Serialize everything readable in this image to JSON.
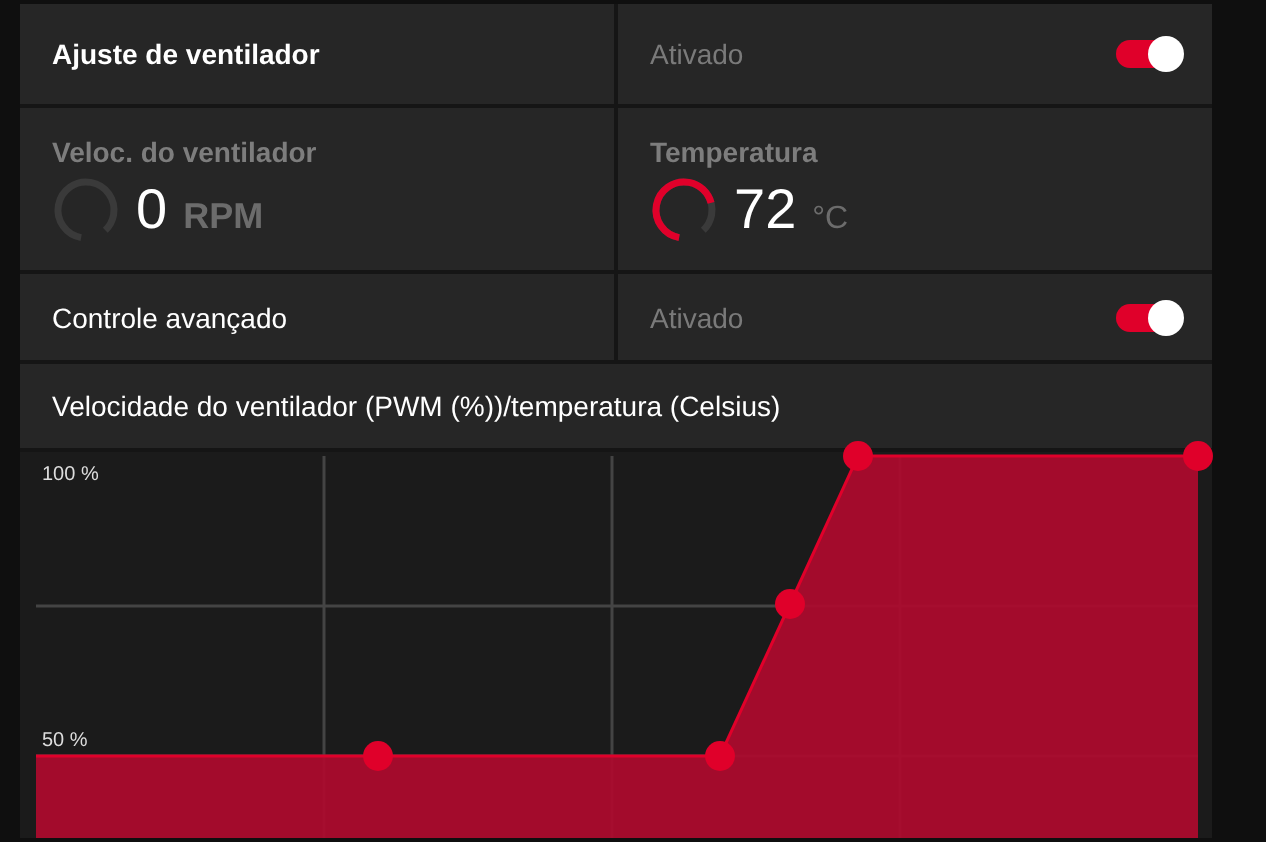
{
  "fan_tuning": {
    "label": "Ajuste de ventilador",
    "status": "Ativado",
    "on": true
  },
  "stats": [
    {
      "label": "Veloc. do ventilador",
      "value": "0",
      "unit": "RPM",
      "kind": "idle"
    },
    {
      "label": "Temperatura",
      "value": "72",
      "unit": "°C",
      "kind": "hot"
    }
  ],
  "advanced_control": {
    "label": "Controle avançado",
    "status": "Ativado",
    "on": true
  },
  "curve": {
    "title": "Velocidade do ventilador (PWM (%))/temperatura (Celsius)",
    "y_labels": [
      "100 %",
      "50 %"
    ]
  }
}
